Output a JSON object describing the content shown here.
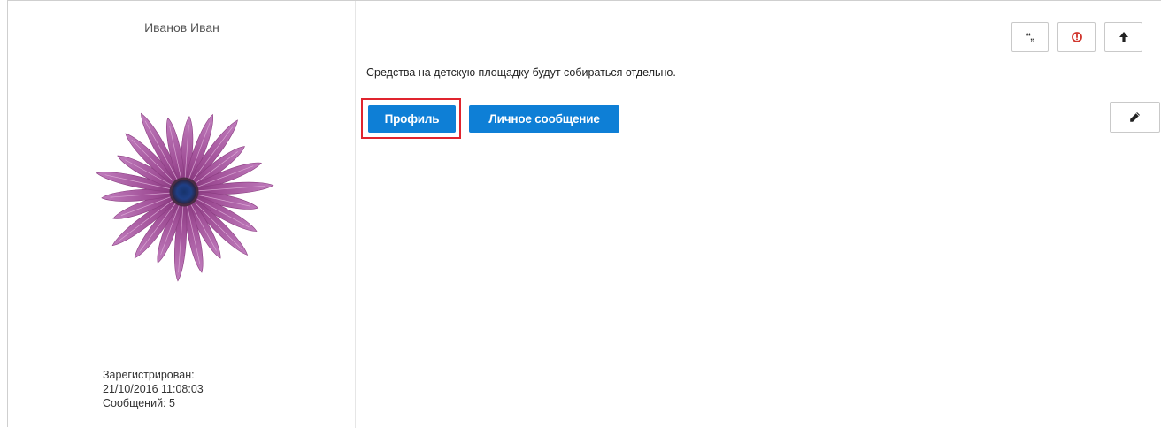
{
  "author": {
    "name": "Иванов Иван",
    "registered_label": "Зарегистрирован:",
    "registered_date": "21/10/2016 11:08:03",
    "messages": "Сообщений: 5"
  },
  "post": {
    "text": "Средства на детскую площадку будут собираться отдельно."
  },
  "buttons": {
    "profile": "Профиль",
    "private_message": "Личное сообщение",
    "quote_glyph": "“„"
  },
  "icons": {
    "quote": "quote-icon",
    "report": "exclamation-circle-icon",
    "top": "arrow-up-icon",
    "edit": "pencil-icon"
  },
  "colors": {
    "primary": "#0e7fd6",
    "highlight": "#e0242e",
    "report_icon": "#d0342c"
  }
}
